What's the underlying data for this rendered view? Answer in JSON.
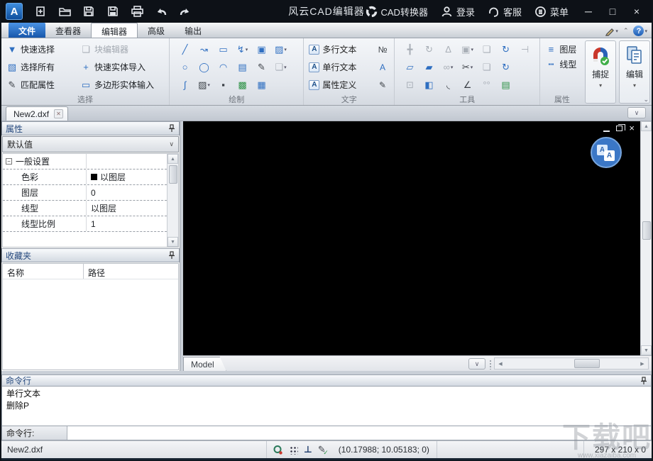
{
  "window": {
    "title": "风云CAD编辑器",
    "min": "─",
    "max": "□",
    "close": "×"
  },
  "titlebar": {
    "quick_icons": [
      "app-logo",
      "new-file",
      "open-file",
      "save",
      "save-pdf",
      "print",
      "undo",
      "redo"
    ],
    "right_items": [
      {
        "icon": "cad-converter-icon",
        "label": "CAD转换器"
      },
      {
        "icon": "user-icon",
        "label": "登录"
      },
      {
        "icon": "headset-icon",
        "label": "客服"
      },
      {
        "icon": "menu-icon",
        "label": "菜单"
      }
    ]
  },
  "ribbon_tabs": {
    "items": [
      {
        "label": "文件"
      },
      {
        "label": "查看器"
      },
      {
        "label": "编辑器"
      },
      {
        "label": "高级"
      },
      {
        "label": "输出"
      }
    ],
    "active": "编辑器"
  },
  "ribbon": {
    "selection": {
      "label": "选择",
      "items": [
        {
          "label": "快速选择",
          "glyph": "▼",
          "c": "b"
        },
        {
          "label": "块编辑器",
          "glyph": "❏",
          "c": "g",
          "disabled": true
        },
        {
          "label": "选择所有",
          "glyph": "▧",
          "c": "b"
        },
        {
          "label": "快速实体导入",
          "glyph": "+",
          "c": "b"
        },
        {
          "label": "匹配属性",
          "glyph": "✎",
          "c": "d"
        },
        {
          "label": "多边形实体输入",
          "glyph": "▭",
          "c": "b"
        }
      ]
    },
    "draw": {
      "label": "绘制",
      "grid": [
        [
          {
            "g": "╱",
            "c": "b"
          },
          {
            "g": "↝",
            "c": "b"
          },
          {
            "g": "▭",
            "c": "b"
          },
          {
            "g": "↯",
            "c": "b",
            "dd": true
          },
          {
            "g": "▣",
            "c": "b"
          },
          {
            "g": "▨",
            "c": "b",
            "dd": true
          }
        ],
        [
          {
            "g": "○",
            "c": "b"
          },
          {
            "g": "◯",
            "c": "b"
          },
          {
            "g": "◠",
            "c": "b"
          },
          {
            "g": "▤",
            "c": "b"
          },
          {
            "g": "✎",
            "c": "d"
          },
          {
            "g": "❏",
            "c": "g",
            "dd": true
          }
        ],
        [
          {
            "g": "∫",
            "c": "b"
          },
          {
            "g": "▨",
            "c": "d",
            "dd": true
          },
          {
            "g": "▪",
            "c": "d"
          },
          {
            "g": "▩",
            "c": "gr"
          },
          {
            "g": "▦",
            "c": "b"
          }
        ]
      ]
    },
    "text": {
      "label": "文字",
      "items": [
        {
          "label": "多行文本"
        },
        {
          "label": "单行文本"
        },
        {
          "label": "属性定义"
        }
      ],
      "side_icons": [
        "№",
        "A",
        "✎"
      ]
    },
    "tools": {
      "label": "工具",
      "grid": [
        [
          {
            "g": "╋",
            "c": "g"
          },
          {
            "g": "↻",
            "c": "g"
          },
          {
            "g": "∆",
            "c": "g"
          },
          {
            "g": "▣",
            "c": "g",
            "dd": true
          },
          {
            "g": "❏",
            "c": "g"
          },
          {
            "g": "↻",
            "c": "b"
          },
          {
            "g": "⊣",
            "c": "g"
          }
        ],
        [
          {
            "g": "▱",
            "c": "b"
          },
          {
            "g": "▰",
            "c": "b"
          },
          {
            "g": "∞",
            "c": "g",
            "dd": true
          },
          {
            "g": "✂",
            "c": "d",
            "dd": true
          },
          {
            "g": "❏",
            "c": "g"
          },
          {
            "g": "↻",
            "c": "b"
          }
        ],
        [
          {
            "g": "⊡",
            "c": "g"
          },
          {
            "g": "◧",
            "c": "b"
          },
          {
            "g": "◟",
            "c": "d"
          },
          {
            "g": "∠",
            "c": "d"
          },
          {
            "g": "°°",
            "c": "g"
          },
          {
            "g": "▤",
            "c": "gr"
          }
        ]
      ]
    },
    "props": {
      "label": "属性",
      "items": [
        {
          "label": "图层",
          "glyph": "≡",
          "c": "b"
        },
        {
          "label": "线型",
          "glyph": "┅",
          "c": "b"
        }
      ]
    },
    "big_buttons": [
      {
        "label": "捕捉",
        "icon": "magnet-snap-icon"
      },
      {
        "label": "编辑",
        "icon": "edit-doc-icon"
      }
    ]
  },
  "doc_tabs": {
    "active": "New2.dxf"
  },
  "properties_panel": {
    "title": "属性",
    "preset": "默认值",
    "group": "一般设置",
    "rows": [
      {
        "label": "色彩",
        "value": "以图层",
        "swatch": "#000000"
      },
      {
        "label": "图层",
        "value": "0"
      },
      {
        "label": "线型",
        "value": "以图层"
      },
      {
        "label": "线型比例",
        "value": "1"
      }
    ]
  },
  "favorites_panel": {
    "title": "收藏夹",
    "columns": [
      "名称",
      "路径"
    ]
  },
  "canvas": {
    "model_tab": "Model"
  },
  "command_panel": {
    "title": "命令行",
    "history": [
      "单行文本",
      "删除P"
    ],
    "prompt": "命令行:",
    "input_value": ""
  },
  "statusbar": {
    "file": "New2.dxf",
    "coords": "(10.17988; 10.05183; 0)",
    "dims": "297 x 210 x 0"
  },
  "watermark": {
    "big": "下载吧",
    "small": "www.xiazaiba.com"
  }
}
